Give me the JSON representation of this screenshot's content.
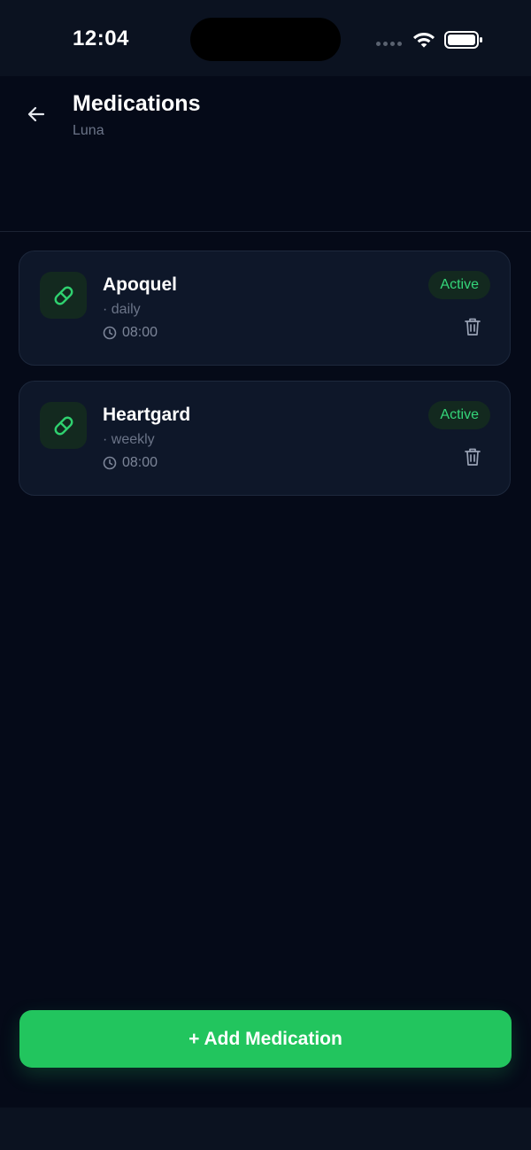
{
  "status_bar": {
    "time": "12:04"
  },
  "header": {
    "title": "Medications",
    "subtitle": "Luna"
  },
  "medications": [
    {
      "name": "Apoquel",
      "frequency": "· daily",
      "time": "08:00",
      "status": "Active",
      "icon": "pill-icon"
    },
    {
      "name": "Heartgard",
      "frequency": "· weekly",
      "time": "08:00",
      "status": "Active",
      "icon": "pill-icon"
    }
  ],
  "actions": {
    "add_label": "+ Add Medication"
  },
  "colors": {
    "background": "#050a18",
    "card": "#0e1729",
    "accent": "#22c55e",
    "badge_text": "#34d67a",
    "muted_text": "#6b7488"
  }
}
